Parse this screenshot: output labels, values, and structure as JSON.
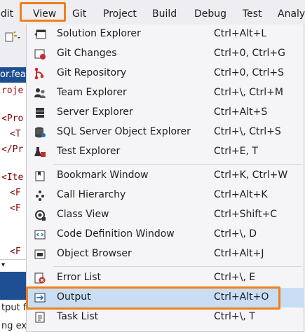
{
  "menubar": {
    "items": [
      {
        "label": "Edit"
      },
      {
        "label": "View"
      },
      {
        "label": "Git"
      },
      {
        "label": "Project"
      },
      {
        "label": "Build"
      },
      {
        "label": "Debug"
      },
      {
        "label": "Test"
      },
      {
        "label": "Analyz"
      }
    ]
  },
  "background": {
    "tab_label": "or.featu",
    "editor_lines": [
      "roje",
      "<Pro",
      "<T",
      "</Pr",
      "<Ite",
      "<F",
      "<F",
      "<F"
    ],
    "output_lines": [
      "tput fr",
      "ng exte"
    ]
  },
  "view_menu": {
    "items": [
      {
        "label": "Solution Explorer",
        "shortcut": "Ctrl+Alt+L",
        "icon": "solution-explorer-icon"
      },
      {
        "label": "Git Changes",
        "shortcut": "Ctrl+0, Ctrl+G",
        "icon": "git-changes-icon"
      },
      {
        "label": "Git Repository",
        "shortcut": "Ctrl+0, Ctrl+S",
        "icon": "git-repository-icon"
      },
      {
        "label": "Team Explorer",
        "shortcut": "Ctrl+\\, Ctrl+M",
        "icon": "team-explorer-icon"
      },
      {
        "label": "Server Explorer",
        "shortcut": "Ctrl+Alt+S",
        "icon": "server-explorer-icon"
      },
      {
        "label": "SQL Server Object Explorer",
        "shortcut": "Ctrl+\\, Ctrl+S",
        "icon": "sql-server-icon"
      },
      {
        "label": "Test Explorer",
        "shortcut": "Ctrl+E, T",
        "icon": "test-explorer-icon"
      },
      {
        "label": "Bookmark Window",
        "shortcut": "Ctrl+K, Ctrl+W",
        "icon": "bookmark-icon"
      },
      {
        "label": "Call Hierarchy",
        "shortcut": "Ctrl+Alt+K",
        "icon": "call-hierarchy-icon"
      },
      {
        "label": "Class View",
        "shortcut": "Ctrl+Shift+C",
        "icon": "class-view-icon"
      },
      {
        "label": "Code Definition Window",
        "shortcut": "Ctrl+\\, D",
        "icon": "code-definition-icon"
      },
      {
        "label": "Object Browser",
        "shortcut": "Ctrl+Alt+J",
        "icon": "object-browser-icon"
      },
      {
        "label": "Error List",
        "shortcut": "Ctrl+\\, E",
        "icon": "error-list-icon"
      },
      {
        "label": "Output",
        "shortcut": "Ctrl+Alt+O",
        "icon": "output-icon"
      },
      {
        "label": "Task List",
        "shortcut": "Ctrl+\\, T",
        "icon": "task-list-icon"
      }
    ]
  },
  "colors": {
    "highlight_box": "#f0801a",
    "active_item": "#c9def5",
    "tab_blue": "#1f4f93"
  }
}
